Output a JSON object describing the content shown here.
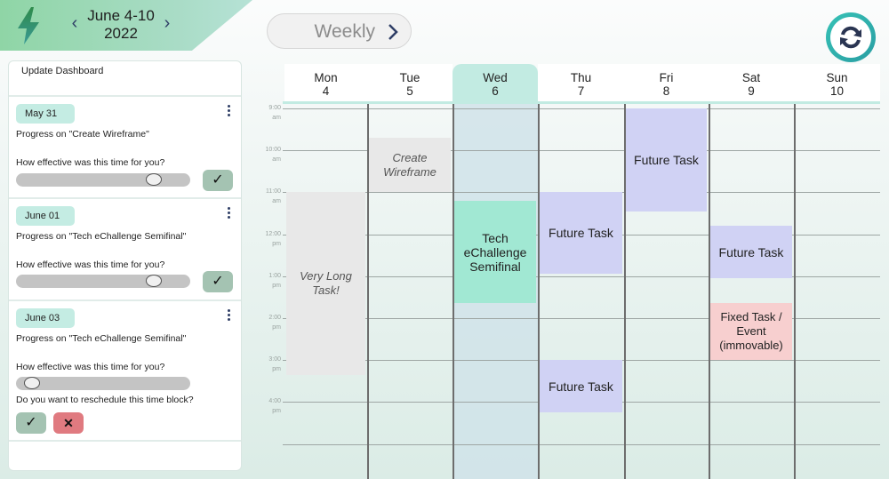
{
  "header": {
    "logo_icon": "lightning-bolt-icon",
    "week_label_line1": "June 4-10",
    "week_label_line2": "2022",
    "prev_icon": "chevron-left-icon",
    "next_icon": "chevron-right-icon",
    "view_selector": "Weekly",
    "sync_icon": "sync-refresh-icon"
  },
  "colors": {
    "accent_teal": "#c2ebe2",
    "future_task": "#d0d2f4",
    "past_task": "#e8e8e8",
    "current_task": "#a1e8d3",
    "fixed_task": "#f7cfcf",
    "confirm_button": "#a4c3b2",
    "reject_button": "#e07a80"
  },
  "dashboard": {
    "title": "Update Dashboard",
    "cards": [
      {
        "date": "May 31",
        "progress": "Progress on \"Create Wireframe\"",
        "question": "How effective was this time for you?",
        "slider_value_pct": 82,
        "confirm_label": "✓"
      },
      {
        "date": "June 01",
        "progress": "Progress on \"Tech eChallenge Semifinal\"",
        "question": "How effective was this time for you?",
        "slider_value_pct": 82,
        "confirm_label": "✓"
      },
      {
        "date": "June 03",
        "progress": "Progress on \"Tech eChallenge Semifinal\"",
        "question": "How effective was this time for you?",
        "slider_value_pct": 5,
        "reschedule_question": "Do you want to reschedule this time block?",
        "confirm_label": "✓",
        "reject_label": "✕"
      }
    ]
  },
  "calendar": {
    "days": [
      {
        "name": "Mon",
        "date": "4"
      },
      {
        "name": "Tue",
        "date": "5"
      },
      {
        "name": "Wed",
        "date": "6",
        "today": true
      },
      {
        "name": "Thu",
        "date": "7"
      },
      {
        "name": "Fri",
        "date": "8"
      },
      {
        "name": "Sat",
        "date": "9"
      },
      {
        "name": "Sun",
        "date": "10"
      }
    ],
    "times": [
      {
        "hour": "9:00",
        "ampm": "am"
      },
      {
        "hour": "10:00",
        "ampm": "am"
      },
      {
        "hour": "11:00",
        "ampm": "am"
      },
      {
        "hour": "12:00",
        "ampm": "pm"
      },
      {
        "hour": "1:00",
        "ampm": "pm"
      },
      {
        "hour": "2:00",
        "ampm": "pm"
      },
      {
        "hour": "3:00",
        "ampm": "pm"
      },
      {
        "hour": "4:00",
        "ampm": "pm"
      }
    ],
    "events": [
      {
        "title": "Create Wireframe",
        "day": 1,
        "start": 9.7,
        "end": 11.0,
        "kind": "past"
      },
      {
        "title": "Very Long Task!",
        "day": 0,
        "start": 11.0,
        "end": 15.35,
        "kind": "past"
      },
      {
        "title": "Tech eChallenge Semifinal",
        "day": 2,
        "start": 11.2,
        "end": 13.65,
        "kind": "current"
      },
      {
        "title": "Future Task",
        "day": 3,
        "start": 11.0,
        "end": 12.95,
        "kind": "future"
      },
      {
        "title": "Future Task",
        "day": 3,
        "start": 15.0,
        "end": 16.25,
        "kind": "future"
      },
      {
        "title": "Future Task",
        "day": 4,
        "start": 9.0,
        "end": 11.45,
        "kind": "future"
      },
      {
        "title": "Future Task",
        "day": 5,
        "start": 11.8,
        "end": 13.05,
        "kind": "future"
      },
      {
        "title": "Fixed Task / Event (immovable)",
        "day": 5,
        "start": 13.65,
        "end": 15.0,
        "kind": "fixed"
      }
    ]
  }
}
